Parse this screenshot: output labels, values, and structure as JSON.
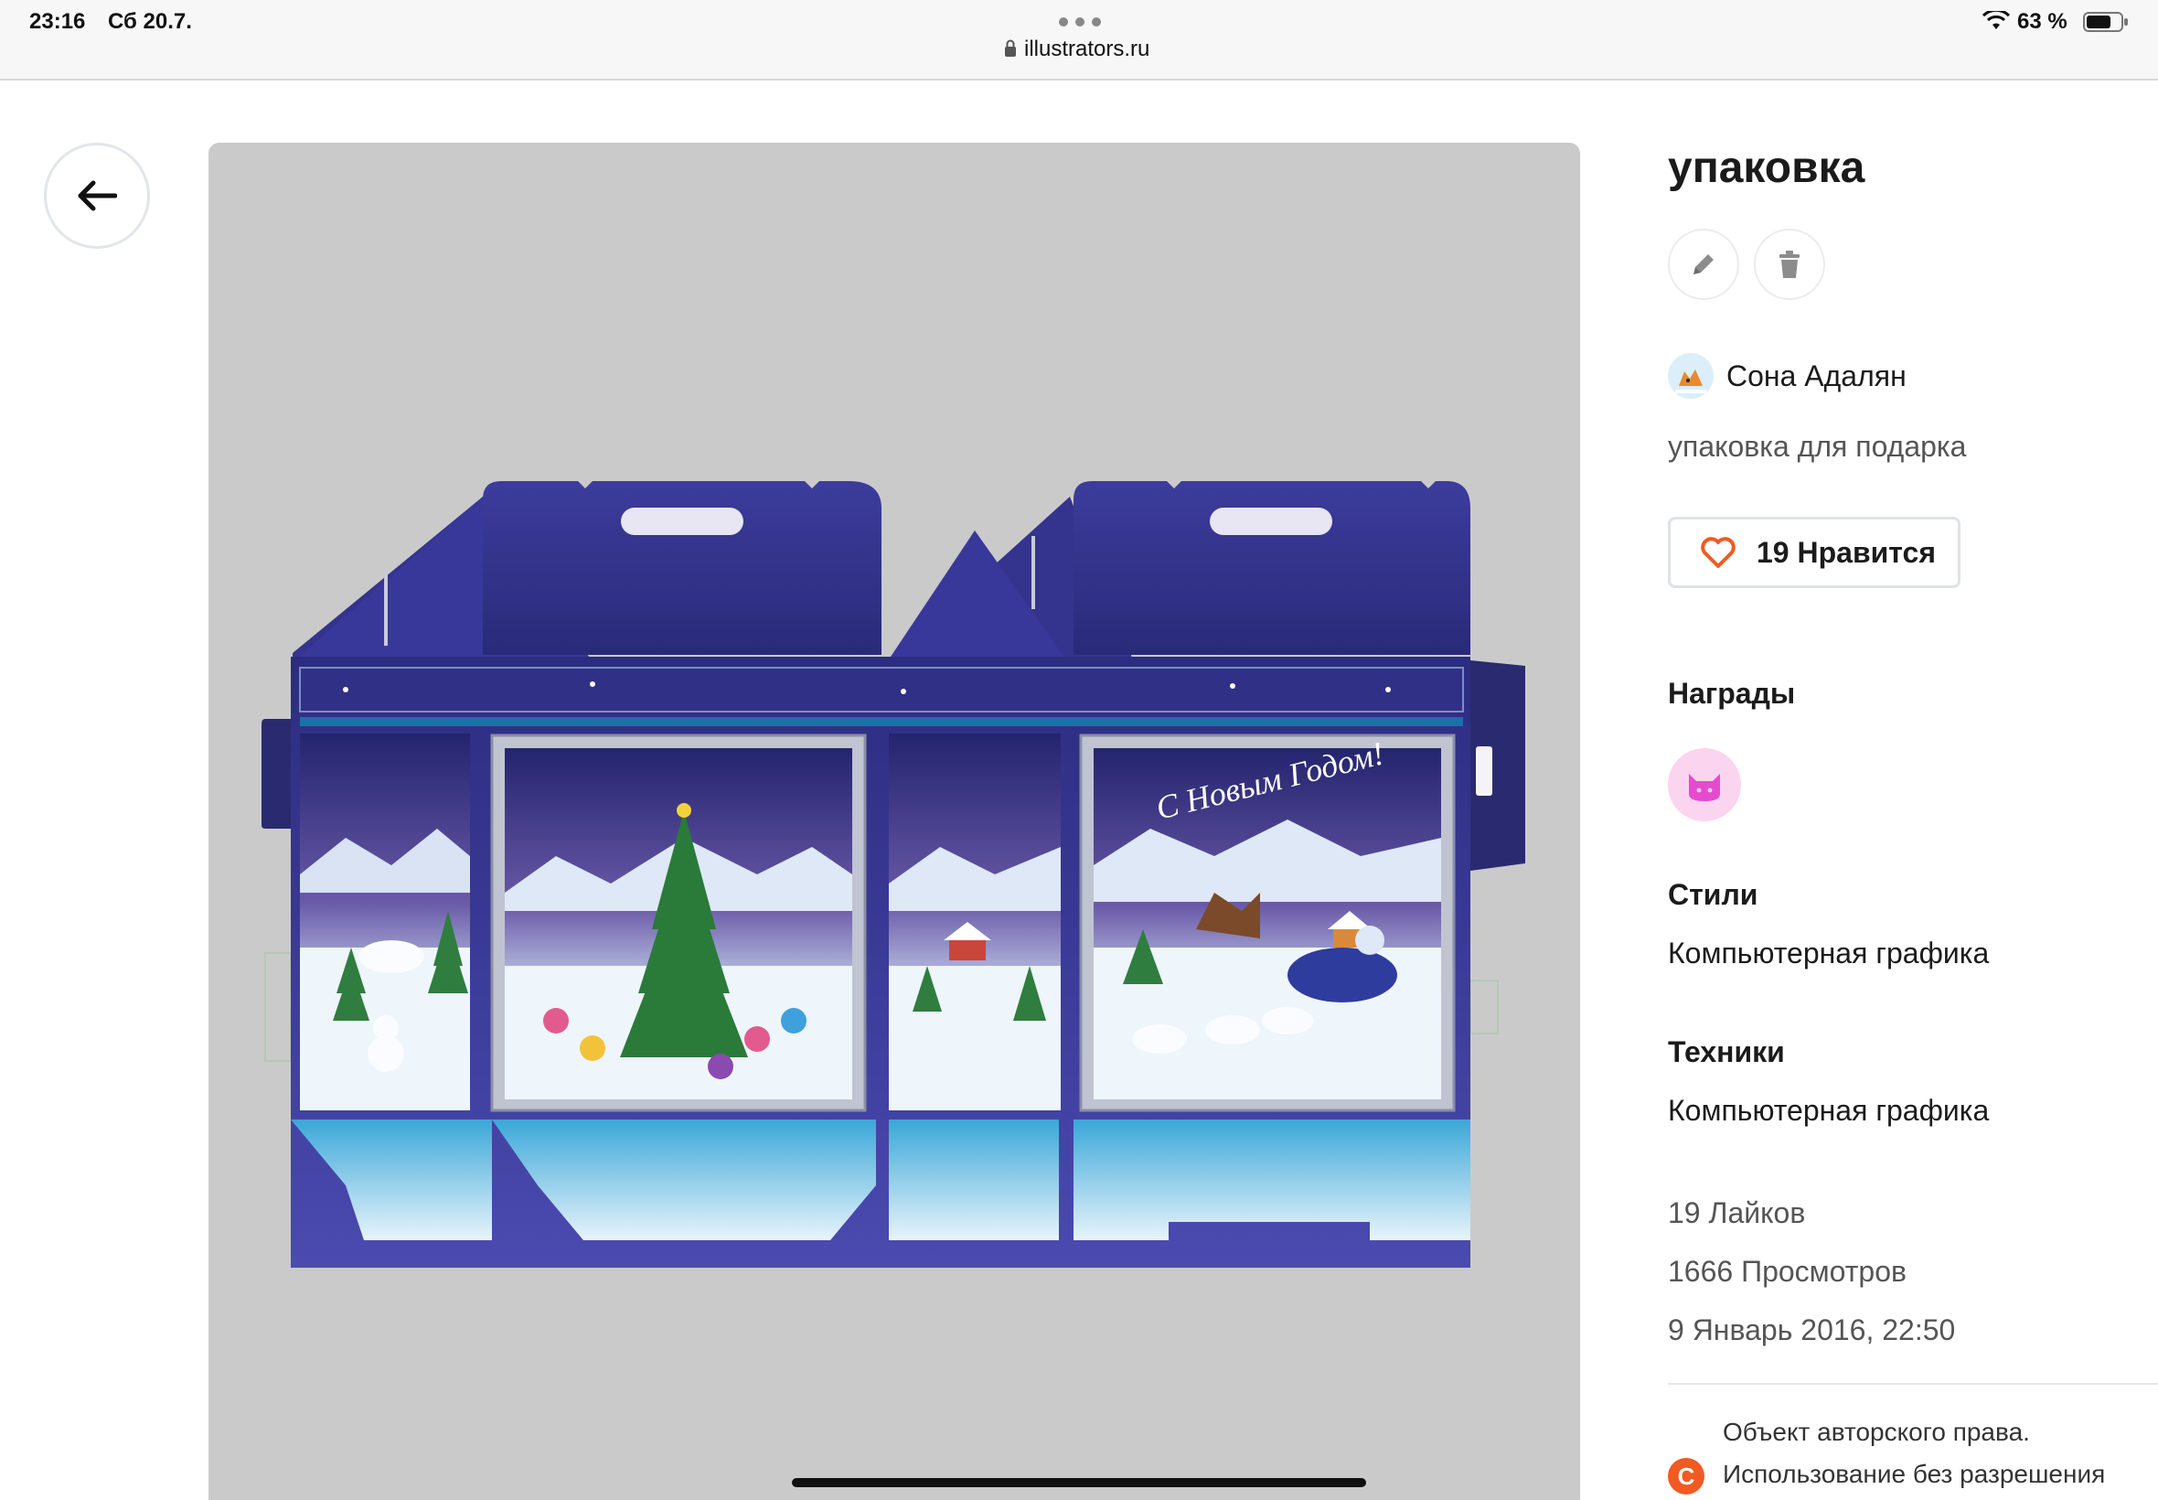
{
  "status_bar": {
    "time": "23:16",
    "date": "Сб 20.7.",
    "url": "illustrators.ru",
    "battery": "63 %"
  },
  "artwork": {
    "greeting": "С Новым Годом!"
  },
  "sidebar": {
    "title": "упаковка",
    "author": "Сона Адалян",
    "description": "упаковка для подарка",
    "like_button": "19 Нравится",
    "awards_heading": "Награды",
    "styles_heading": "Стили",
    "styles_value": "Компьютерная графика",
    "techniques_heading": "Техники",
    "techniques_value": "Компьютерная графика",
    "likes": "19 Лайков",
    "views": "1666 Просмотров",
    "date": "9 Январь 2016, 22:50",
    "copyright_symbol": "C",
    "copyright_line1": "Объект авторского права.",
    "copyright_line2": "Использование без разрешения"
  },
  "colors": {
    "accent": "#f15a22",
    "award": "#fbd4ef",
    "box_blue": "#3c3c9c"
  }
}
